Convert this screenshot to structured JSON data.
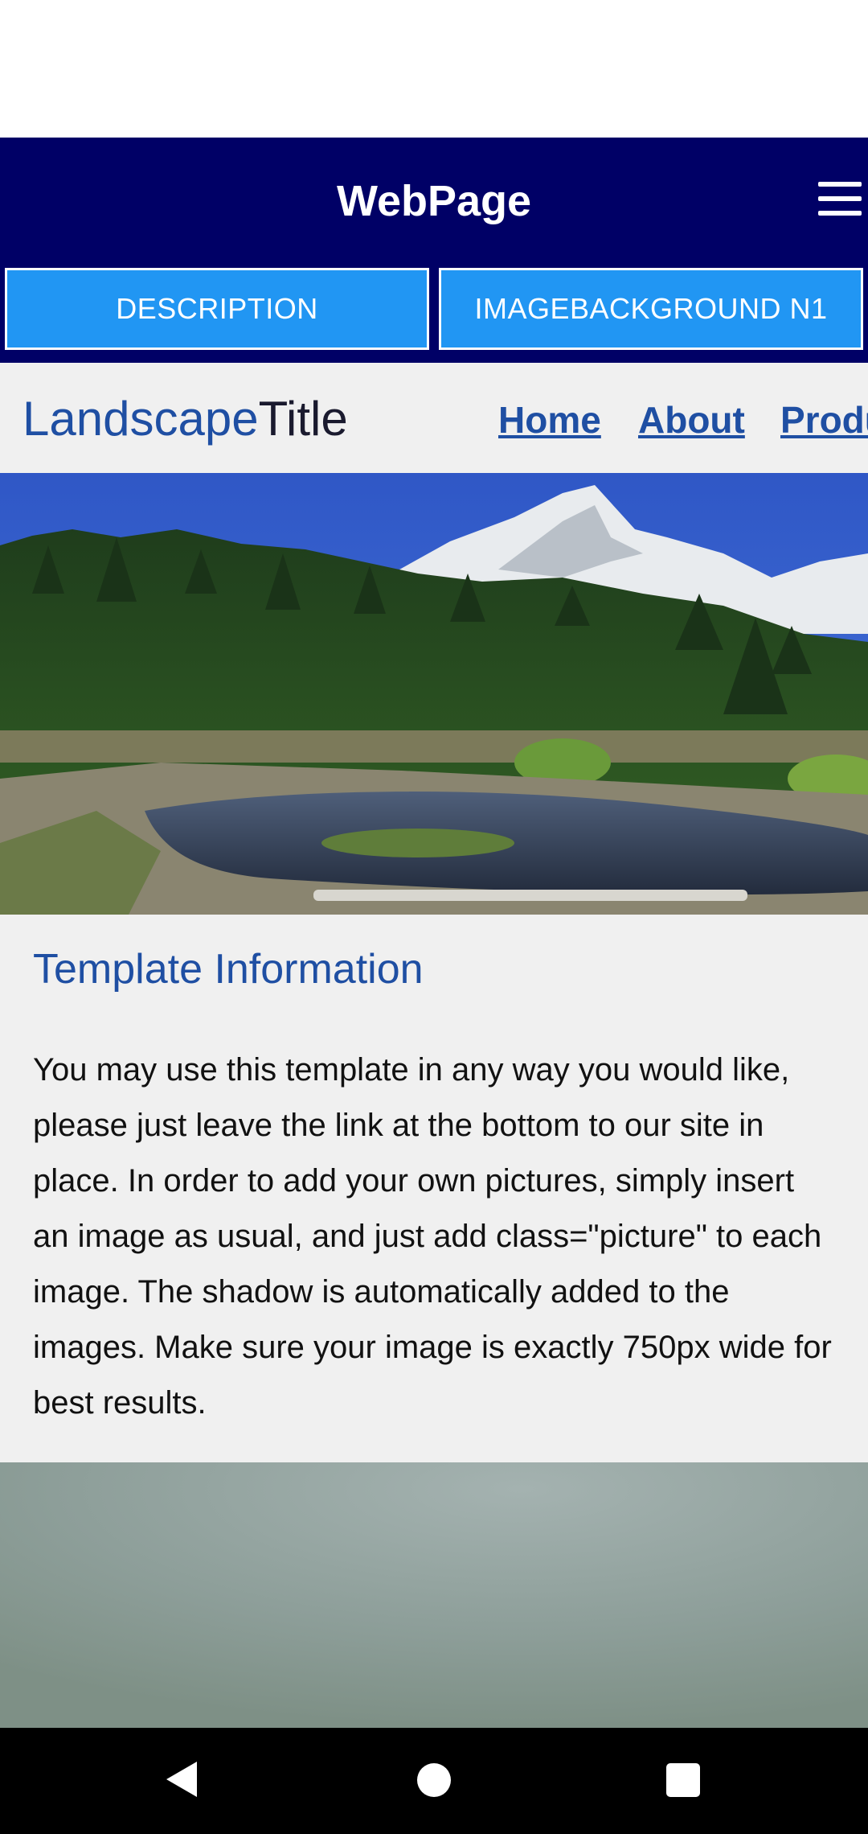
{
  "app_bar": {
    "title": "WebPage",
    "menu_icon": "hamburger-menu-icon",
    "background_color": "#000066"
  },
  "tabs": [
    {
      "label": "DESCRIPTION"
    },
    {
      "label": "IMAGEBACKGROUND N1"
    }
  ],
  "site": {
    "logo_part1": "Landscape",
    "logo_part2": "Title",
    "nav": [
      "Home",
      "About",
      "Products"
    ]
  },
  "content": {
    "heading": "Template Information",
    "paragraph": "You may use this template in any way you would like, please just leave the link at the bottom to our site in place. In order to add your own pictures, simply insert an image as usual, and just add class=\"picture\" to each image. The shadow is automatically added to the images. Make sure your image is exactly 750px wide for best results."
  },
  "system_nav": {
    "back_icon": "back-triangle-icon",
    "home_icon": "home-circle-icon",
    "recents_icon": "recents-square-icon"
  },
  "colors": {
    "accent": "#2196f3",
    "link": "#1f4fa3"
  }
}
